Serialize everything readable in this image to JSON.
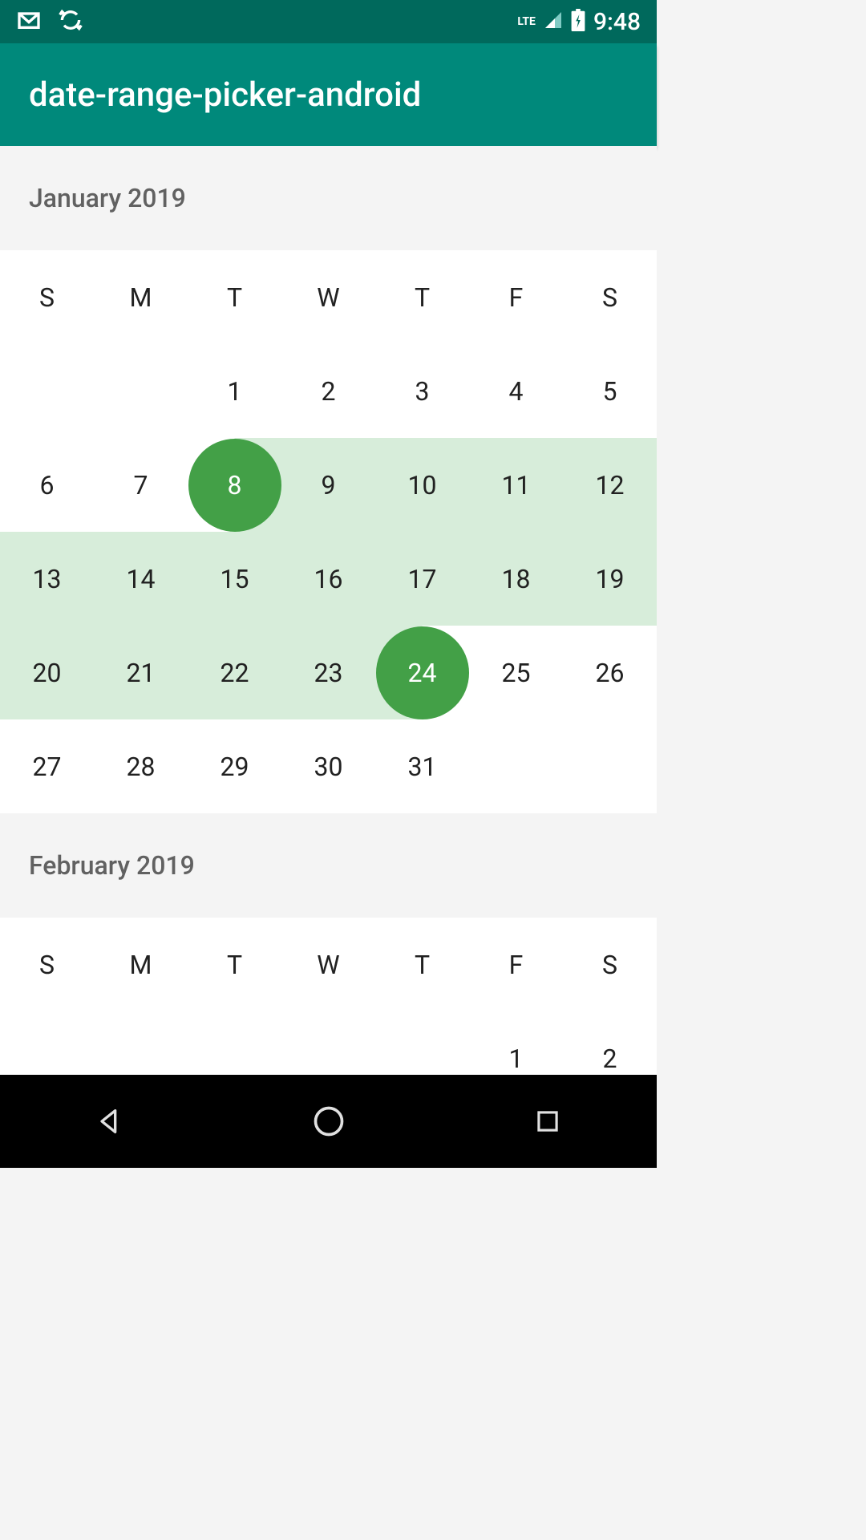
{
  "status_bar": {
    "network_label": "LTE",
    "time": "9:48"
  },
  "app_bar": {
    "title": "date-range-picker-android"
  },
  "weekdays": [
    "S",
    "M",
    "T",
    "W",
    "T",
    "F",
    "S"
  ],
  "months": [
    {
      "title": "January 2019",
      "weeks": [
        [
          {
            "day": "",
            "state": "empty"
          },
          {
            "day": "",
            "state": "empty"
          },
          {
            "day": "1",
            "state": "normal"
          },
          {
            "day": "2",
            "state": "normal"
          },
          {
            "day": "3",
            "state": "normal"
          },
          {
            "day": "4",
            "state": "normal"
          },
          {
            "day": "5",
            "state": "normal"
          }
        ],
        [
          {
            "day": "6",
            "state": "normal"
          },
          {
            "day": "7",
            "state": "normal"
          },
          {
            "day": "8",
            "state": "range-start"
          },
          {
            "day": "9",
            "state": "in-range"
          },
          {
            "day": "10",
            "state": "in-range"
          },
          {
            "day": "11",
            "state": "in-range"
          },
          {
            "day": "12",
            "state": "in-range"
          }
        ],
        [
          {
            "day": "13",
            "state": "in-range"
          },
          {
            "day": "14",
            "state": "in-range"
          },
          {
            "day": "15",
            "state": "in-range"
          },
          {
            "day": "16",
            "state": "in-range"
          },
          {
            "day": "17",
            "state": "in-range"
          },
          {
            "day": "18",
            "state": "in-range"
          },
          {
            "day": "19",
            "state": "in-range"
          }
        ],
        [
          {
            "day": "20",
            "state": "in-range"
          },
          {
            "day": "21",
            "state": "in-range"
          },
          {
            "day": "22",
            "state": "in-range"
          },
          {
            "day": "23",
            "state": "in-range"
          },
          {
            "day": "24",
            "state": "range-end"
          },
          {
            "day": "25",
            "state": "normal"
          },
          {
            "day": "26",
            "state": "normal"
          }
        ],
        [
          {
            "day": "27",
            "state": "normal"
          },
          {
            "day": "28",
            "state": "normal"
          },
          {
            "day": "29",
            "state": "normal"
          },
          {
            "day": "30",
            "state": "normal"
          },
          {
            "day": "31",
            "state": "normal"
          },
          {
            "day": "",
            "state": "empty"
          },
          {
            "day": "",
            "state": "empty"
          }
        ]
      ]
    },
    {
      "title": "February 2019",
      "weeks": [
        [
          {
            "day": "",
            "state": "empty"
          },
          {
            "day": "",
            "state": "empty"
          },
          {
            "day": "",
            "state": "empty"
          },
          {
            "day": "",
            "state": "empty"
          },
          {
            "day": "",
            "state": "empty"
          },
          {
            "day": "1",
            "state": "normal"
          },
          {
            "day": "2",
            "state": "normal"
          }
        ]
      ]
    }
  ],
  "colors": {
    "status_bar": "#00695c",
    "app_bar": "#00897b",
    "range_bg": "#d7edda",
    "range_circle": "#43a047"
  }
}
